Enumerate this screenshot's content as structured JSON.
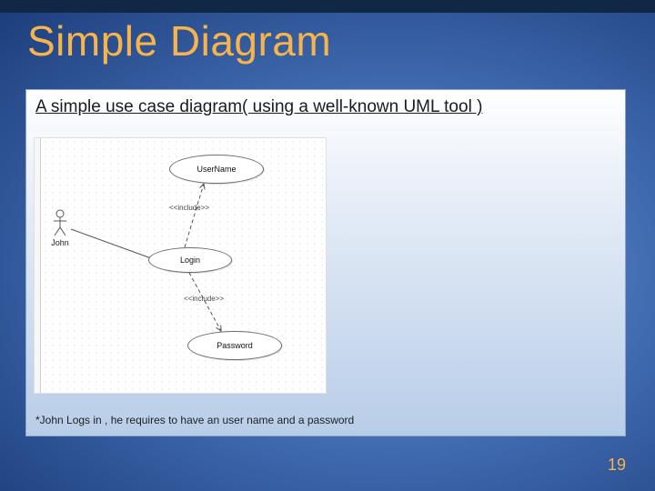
{
  "title": "Simple Diagram",
  "subtitle": "A simple use case diagram( using a well-known UML tool )",
  "caption": "*John Logs in , he requires to have an user name and a password",
  "page_number": "19",
  "diagram": {
    "actor": "John",
    "usecases": {
      "username": "UserName",
      "login": "Login",
      "password": "Password"
    },
    "stereotype": "<<include>>"
  }
}
